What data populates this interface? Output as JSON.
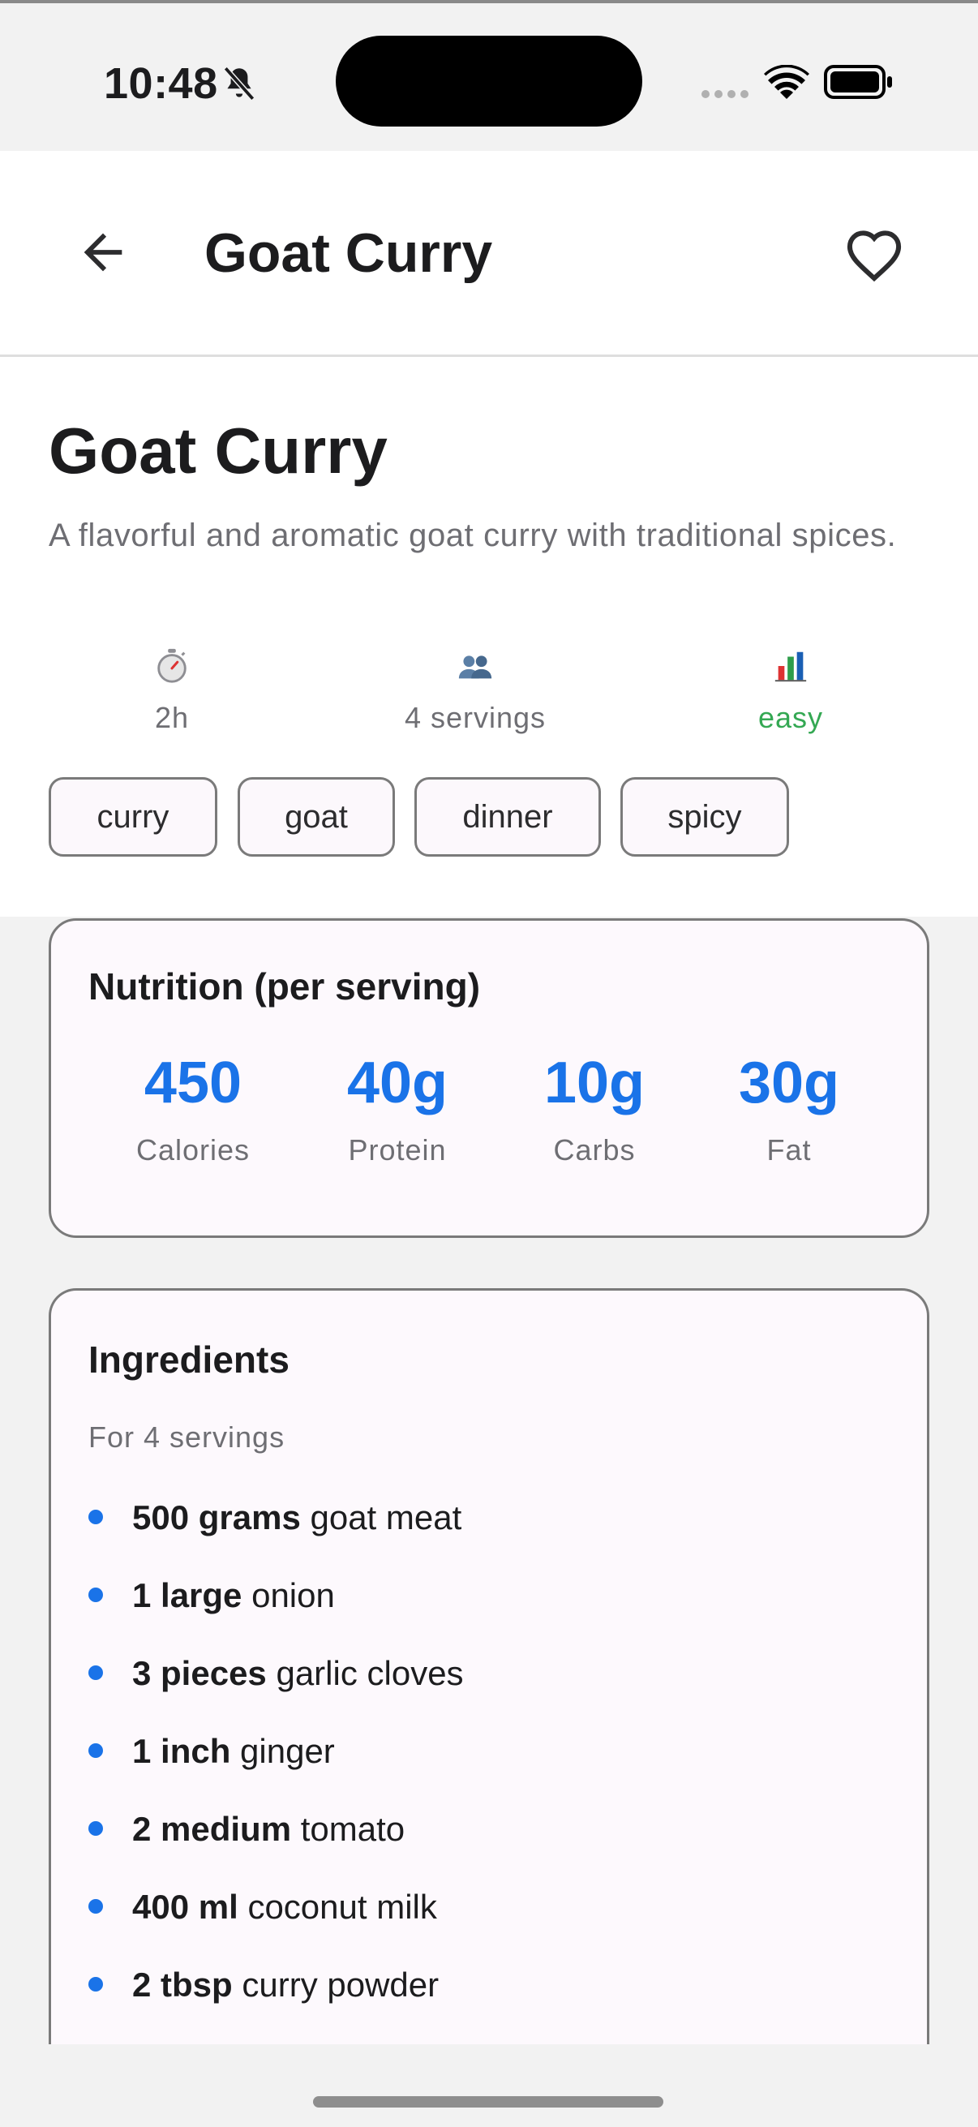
{
  "status_bar": {
    "time": "10:48",
    "icons": [
      "bell-slash-icon",
      "cellular-signal-icon",
      "wifi-icon",
      "battery-icon"
    ]
  },
  "app_bar": {
    "title": "Goat Curry",
    "back_icon": "arrow-left-icon",
    "favorite_icon": "heart-outline-icon"
  },
  "recipe": {
    "title": "Goat Curry",
    "description": "A flavorful and aromatic goat curry with traditional spices.",
    "meta": {
      "time": "2h",
      "servings": "4 servings",
      "difficulty": "easy",
      "icons": [
        "stopwatch-icon",
        "people-icon",
        "bar-chart-icon"
      ]
    },
    "tags": [
      "curry",
      "goat",
      "dinner",
      "spicy"
    ]
  },
  "nutrition": {
    "title": "Nutrition (per serving)",
    "items": [
      {
        "value": "450",
        "label": "Calories"
      },
      {
        "value": "40g",
        "label": "Protein"
      },
      {
        "value": "10g",
        "label": "Carbs"
      },
      {
        "value": "30g",
        "label": "Fat"
      }
    ]
  },
  "ingredients": {
    "title": "Ingredients",
    "servings_note": "For 4 servings",
    "items": [
      {
        "qty": "500 grams",
        "name": "goat meat"
      },
      {
        "qty": "1 large",
        "name": "onion"
      },
      {
        "qty": "3 pieces",
        "name": "garlic cloves"
      },
      {
        "qty": "1 inch",
        "name": "ginger"
      },
      {
        "qty": "2 medium",
        "name": "tomato"
      },
      {
        "qty": "400 ml",
        "name": "coconut milk"
      },
      {
        "qty": "2 tbsp",
        "name": "curry powder"
      }
    ]
  },
  "colors": {
    "accent": "#1a73e8",
    "difficulty_easy": "#34a853",
    "muted_text": "#6e6e73",
    "background": "#f2f2f2"
  }
}
